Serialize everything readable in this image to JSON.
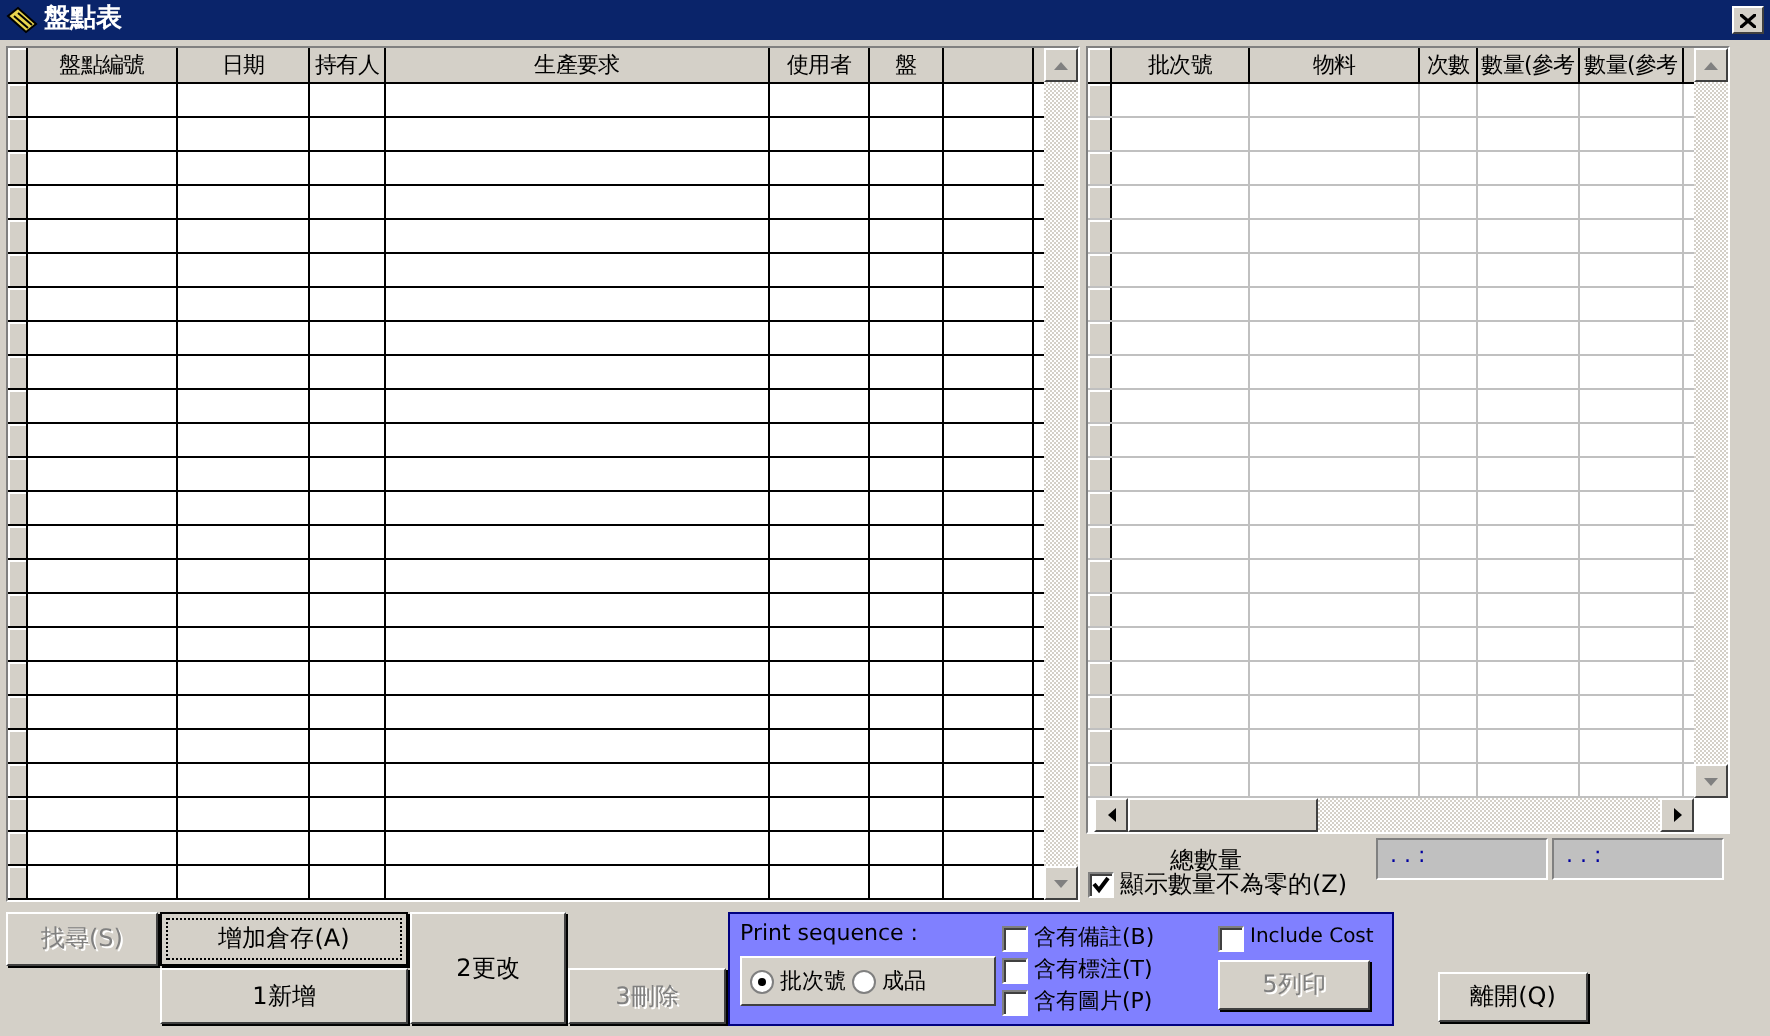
{
  "window": {
    "title": "盤點表"
  },
  "count_table": {
    "columns": [
      "盤點編號",
      "日期",
      "持有人",
      "生產要求",
      "使用者",
      "盤"
    ]
  },
  "batch_table": {
    "columns": [
      "批次號",
      "物料",
      "次數",
      "數量(參考",
      "數量(參考"
    ]
  },
  "totals": {
    "label": "總數量",
    "fields": [
      ". . :",
      ". . :"
    ]
  },
  "show_nonzero": {
    "label": "顯示數量不為零的(Z)",
    "checked": true
  },
  "buttons": [
    {
      "label": "找尋(S)",
      "disabled": true,
      "focused": false
    },
    {
      "label": "增加倉存(A)",
      "disabled": false,
      "focused": true
    },
    {
      "label": "1新增",
      "disabled": false,
      "focused": false
    },
    {
      "label": "2更改",
      "disabled": false,
      "focused": false
    },
    {
      "label": "3刪除",
      "disabled": true,
      "focused": false
    }
  ],
  "print_panel": {
    "title": "Print sequence :",
    "sequence": [
      {
        "label": "批次號",
        "selected": true
      },
      {
        "label": "成品",
        "selected": false
      }
    ],
    "options": [
      {
        "label": "含有備註(B)",
        "checked": false
      },
      {
        "label": "含有標注(T)",
        "checked": false
      },
      {
        "label": "含有圖片(P)",
        "checked": false
      }
    ],
    "include_cost": {
      "label": "Include Cost",
      "checked": false
    },
    "print_button": {
      "label": "5列印",
      "disabled": true
    }
  },
  "exit_button": {
    "label": "離開(Q)",
    "disabled": false
  }
}
